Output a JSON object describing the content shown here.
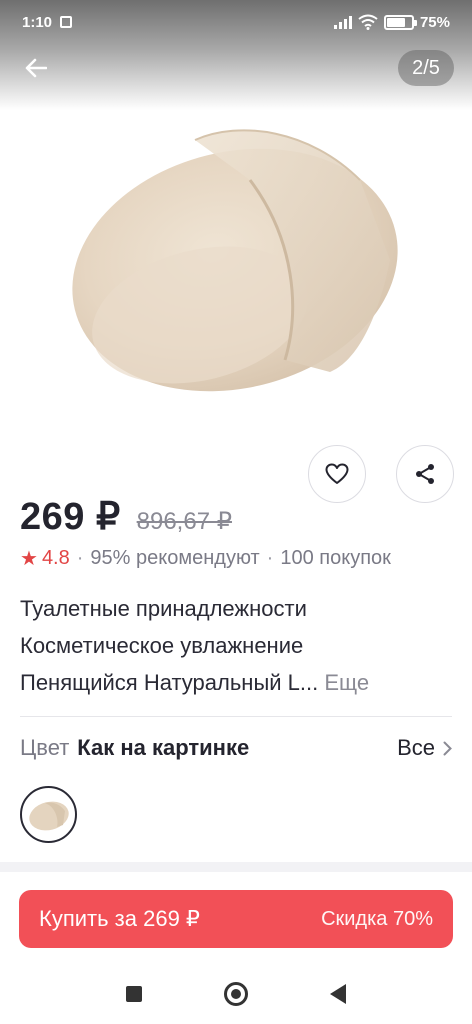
{
  "status_bar": {
    "time": "1:10",
    "battery": "75%",
    "battery_level": 0.75
  },
  "gallery": {
    "page_counter": "2/5"
  },
  "product": {
    "price": "269 ₽",
    "old_price": "896,67 ₽",
    "rating": "4.8",
    "recommend": "95% рекомендуют",
    "purchases": "100 покупок",
    "title_lines": [
      "Туалетные принадлежности",
      "Косметическое увлажнение",
      "Пенящийся Натуральный L..."
    ],
    "more_label": "Еще"
  },
  "variant": {
    "color_label": "Цвет",
    "color_value": "Как на картинке",
    "all_label": "Все"
  },
  "buy": {
    "label": "Купить за 269 ₽",
    "discount": "Скидка 70%"
  },
  "colors": {
    "accent": "#f25057",
    "rating": "#e24545",
    "text": "#24242e"
  },
  "icons": {
    "back": "arrow-left-icon",
    "favorite": "heart-icon",
    "share": "share-icon",
    "chevron": "chevron-right-icon"
  }
}
